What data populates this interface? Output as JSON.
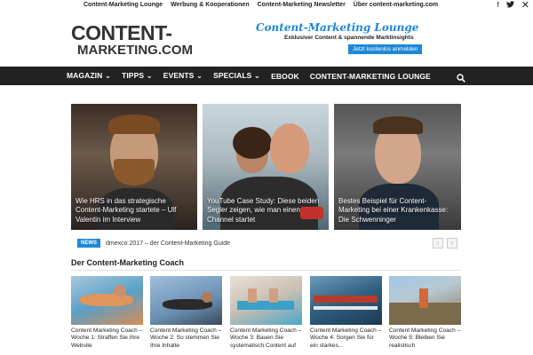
{
  "topbar": {
    "links": [
      "Content-Marketing Lounge",
      "Werbung & Kooperationen",
      "Content-Marketing Newsletter",
      "Über content-marketing.com"
    ],
    "social_icons": [
      "facebook-icon",
      "twitter-icon",
      "x-twitter-icon"
    ]
  },
  "header": {
    "logo_line1": "CONTENT-",
    "logo_line2": "MARKETING.COM",
    "banner": {
      "title": "Content-Marketing Lounge",
      "subtitle": "Exklusiver Content & spannende Marktinsights",
      "button": "Jetzt kostenlos anmelden"
    }
  },
  "nav": {
    "items": [
      "MAGAZIN ⌄",
      "TIPPS ⌄",
      "EVENTS ⌄",
      "SPECIALS ⌄",
      "EBOOK",
      "CONTENT-MARKETING LOUNGE"
    ]
  },
  "featured": [
    {
      "caption": "Wie HRS in das strategische Content-Marketing startete – Ulf Valentin im Interview"
    },
    {
      "caption": "YouTube Case Study: Diese beiden Segler zeigen, wie man einen Channel startet"
    },
    {
      "caption": "Bestes Beispiel für Content-Marketing bei einer Krankenkasse: Die Schwenninger"
    }
  ],
  "ticker": {
    "badge": "NEWS",
    "text": "dmexco 2017 – der Content-Marketing Guide"
  },
  "section": {
    "title": "Der Content-Marketing Coach",
    "cards": [
      {
        "title": "Content Marketing Coach – Woche 1: Straffen Sie Ihre Website"
      },
      {
        "title": "Content Marketing Coach – Woche 2: So stemmen Sie Ihre Inhalte"
      },
      {
        "title": "Content Marketing Coach – Woche 3: Bauen Sie systematisch Content auf"
      },
      {
        "title": "Content Marketing Coach – Woche 4: Sorgen Sie für ein starkes..."
      },
      {
        "title": "Content Marketing Coach – Woche 5: Bleiben Sie realistisch"
      }
    ]
  },
  "colors": {
    "accent": "#1e88d8",
    "nav_bg": "#222222"
  }
}
